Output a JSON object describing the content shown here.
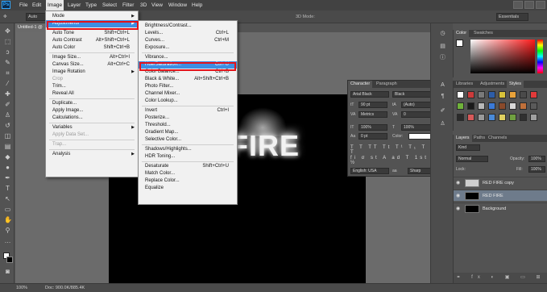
{
  "app": {
    "logo": "Ps"
  },
  "menubar": [
    "File",
    "Edit",
    "Image",
    "Layer",
    "Type",
    "Select",
    "Filter",
    "3D",
    "View",
    "Window",
    "Help"
  ],
  "options_bar": {
    "tool_value": "Auto",
    "mode_3d": "3D Mode:",
    "workspace": "Essentials"
  },
  "document": {
    "tab_title": "Untitled-1 @",
    "text": "FIRE"
  },
  "status": {
    "zoom": "100%",
    "doc": "Doc: 900.0K/885.4K"
  },
  "image_menu": [
    {
      "label": "Mode",
      "shortcut": "",
      "submenu": true
    },
    {
      "label": "Adjustments",
      "shortcut": "",
      "submenu": true,
      "highlight": true
    },
    {
      "sep": true
    },
    {
      "label": "Auto Tone",
      "shortcut": "Shift+Ctrl+L"
    },
    {
      "label": "Auto Contrast",
      "shortcut": "Alt+Shift+Ctrl+L"
    },
    {
      "label": "Auto Color",
      "shortcut": "Shift+Ctrl+B"
    },
    {
      "sep": true
    },
    {
      "label": "Image Size...",
      "shortcut": "Alt+Ctrl+I"
    },
    {
      "label": "Canvas Size...",
      "shortcut": "Alt+Ctrl+C"
    },
    {
      "label": "Image Rotation",
      "shortcut": "",
      "submenu": true
    },
    {
      "label": "Crop",
      "shortcut": "",
      "disabled": true
    },
    {
      "label": "Trim...",
      "shortcut": ""
    },
    {
      "label": "Reveal All",
      "shortcut": ""
    },
    {
      "sep": true
    },
    {
      "label": "Duplicate...",
      "shortcut": ""
    },
    {
      "label": "Apply Image...",
      "shortcut": ""
    },
    {
      "label": "Calculations...",
      "shortcut": ""
    },
    {
      "sep": true
    },
    {
      "label": "Variables",
      "shortcut": "",
      "submenu": true
    },
    {
      "label": "Apply Data Set...",
      "shortcut": "",
      "disabled": true
    },
    {
      "sep": true
    },
    {
      "label": "Trap...",
      "shortcut": "",
      "disabled": true
    },
    {
      "sep": true
    },
    {
      "label": "Analysis",
      "shortcut": "",
      "submenu": true
    }
  ],
  "adjustments_menu": [
    {
      "label": "Brightness/Contrast...",
      "shortcut": ""
    },
    {
      "label": "Levels...",
      "shortcut": "Ctrl+L"
    },
    {
      "label": "Curves...",
      "shortcut": "Ctrl+M"
    },
    {
      "label": "Exposure...",
      "shortcut": ""
    },
    {
      "sep": true
    },
    {
      "label": "Vibrance...",
      "shortcut": ""
    },
    {
      "label": "Hue/Saturation...",
      "shortcut": "Ctrl+U",
      "highlight": true
    },
    {
      "label": "Color Balance...",
      "shortcut": "Ctrl+B"
    },
    {
      "label": "Black & White...",
      "shortcut": "Alt+Shift+Ctrl+B"
    },
    {
      "label": "Photo Filter...",
      "shortcut": ""
    },
    {
      "label": "Channel Mixer...",
      "shortcut": ""
    },
    {
      "label": "Color Lookup...",
      "shortcut": ""
    },
    {
      "sep": true
    },
    {
      "label": "Invert",
      "shortcut": "Ctrl+I"
    },
    {
      "label": "Posterize...",
      "shortcut": ""
    },
    {
      "label": "Threshold...",
      "shortcut": ""
    },
    {
      "label": "Gradient Map...",
      "shortcut": ""
    },
    {
      "label": "Selective Color...",
      "shortcut": ""
    },
    {
      "sep": true
    },
    {
      "label": "Shadows/Highlights...",
      "shortcut": ""
    },
    {
      "label": "HDR Toning...",
      "shortcut": ""
    },
    {
      "sep": true
    },
    {
      "label": "Desaturate",
      "shortcut": "Shift+Ctrl+U"
    },
    {
      "label": "Match Color...",
      "shortcut": ""
    },
    {
      "label": "Replace Color...",
      "shortcut": ""
    },
    {
      "label": "Equalize",
      "shortcut": ""
    }
  ],
  "character_panel": {
    "tabs": [
      "Character",
      "Paragraph"
    ],
    "font_family": "Arial Black",
    "font_style": "Black",
    "size": "90 pt",
    "leading": "(Auto)",
    "kerning": "Metrics",
    "tracking": "0",
    "vscale": "100%",
    "hscale": "100%",
    "baseline": "0 pt",
    "color_label": "Color:",
    "language": "English: USA",
    "aa": "aa",
    "antialias": "Sharp",
    "style_buttons": [
      "T",
      "T",
      "TT",
      "Tt",
      "T¹",
      "T₁",
      "T",
      "T"
    ],
    "opentype_buttons": [
      "fi",
      "σ",
      "st",
      "A",
      "ad",
      "T",
      "1st",
      "½"
    ]
  },
  "color_panel": {
    "tabs": [
      "Color",
      "Swatches"
    ]
  },
  "adjust_panel": {
    "tabs": [
      "Libraries",
      "Adjustments",
      "Styles"
    ]
  },
  "layers_panel": {
    "tabs": [
      "Layers",
      "Paths",
      "Channels"
    ],
    "kind": "Kind",
    "blend": "Normal",
    "opacity_label": "Opacity:",
    "opacity": "100%",
    "lock_label": "Lock:",
    "fill_label": "Fill:",
    "fill": "100%",
    "layers": [
      {
        "name": "RED FIRE copy",
        "selected": false
      },
      {
        "name": "RED FIRE",
        "selected": true
      },
      {
        "name": "Background",
        "selected": false
      }
    ]
  },
  "colors": {
    "highlight": "#3d8ee3",
    "red_box": "#e4141b",
    "selected_layer": "#6e7b8b"
  }
}
